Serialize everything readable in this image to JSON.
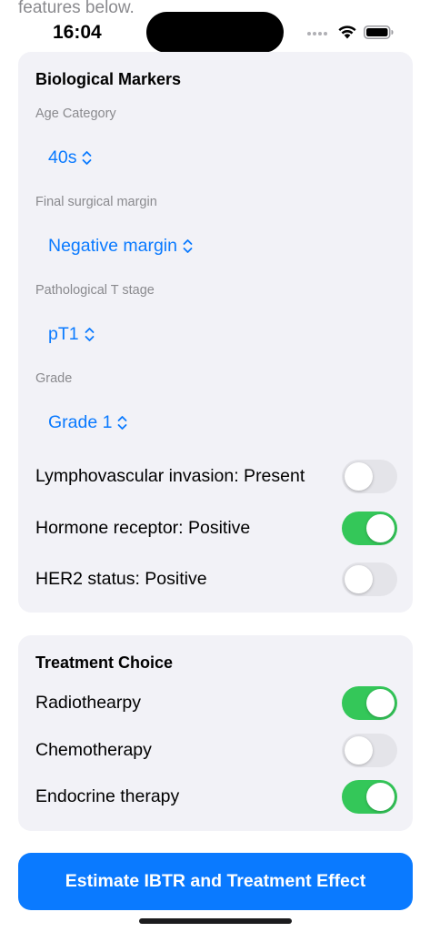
{
  "scroll_peek_text": "features below.",
  "status_bar": {
    "time": "16:04"
  },
  "biological_markers": {
    "title": "Biological Markers",
    "age": {
      "label": "Age Category",
      "value": "40s"
    },
    "margin": {
      "label": "Final surgical margin",
      "value": "Negative margin"
    },
    "t_stage": {
      "label": "Pathological T stage",
      "value": "pT1"
    },
    "grade": {
      "label": "Grade",
      "value": "Grade 1"
    },
    "toggles": [
      {
        "label": "Lymphovascular invasion: Present",
        "on": false
      },
      {
        "label": "Hormone receptor: Positive",
        "on": true
      },
      {
        "label": "HER2 status: Positive",
        "on": false
      }
    ]
  },
  "treatment_choice": {
    "title": "Treatment Choice",
    "toggles": [
      {
        "label": "Radiothearpy",
        "on": true
      },
      {
        "label": "Chemotherapy",
        "on": false
      },
      {
        "label": "Endocrine therapy",
        "on": true
      }
    ]
  },
  "primary_button_label": "Estimate IBTR and Treatment Effect",
  "colors": {
    "accent": "#0a7aff",
    "toggle_on": "#34c759",
    "toggle_off": "#e4e4e9",
    "card_background": "#f2f2f7"
  }
}
